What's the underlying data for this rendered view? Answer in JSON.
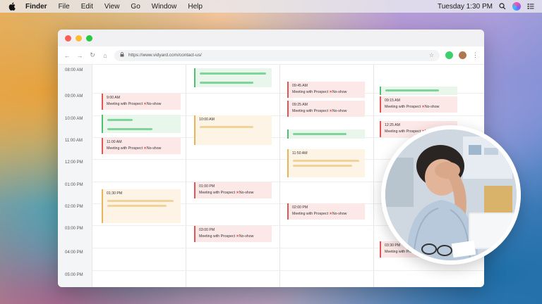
{
  "menubar": {
    "app_name": "Finder",
    "items": [
      "File",
      "Edit",
      "View",
      "Go",
      "Window",
      "Help"
    ],
    "clock": "Tuesday 1:30 PM",
    "icons": [
      "apple-icon",
      "search-icon",
      "siri-icon",
      "control-center-icon"
    ]
  },
  "browser": {
    "url": "https://www.vidyard.com/contact-us/",
    "traffic_lights": {
      "close": "#ff5f57",
      "minimize": "#febc2e",
      "zoom": "#28c840"
    }
  },
  "calendar": {
    "time_labels": [
      "08:00 AM",
      "09:00 AM",
      "10:00 AM",
      "11:00 AM",
      "12:00 PM",
      "01:00 PM",
      "02:00 PM",
      "03:00 PM",
      "04:00 PM",
      "05:00 PM"
    ],
    "events": {
      "e1_time": "9:00 AM",
      "e2_time": "11:00 AM",
      "e3_time": "01:30 PM",
      "e4_time": "10:00 AM",
      "e5_time": "01:00 PM",
      "e6_time": "03:00 PM",
      "e7_time": "09:45 AM",
      "e8_time": "09:25 AM",
      "e9_time": "11:50 AM",
      "e10_time": "02:00 PM",
      "e11_time": "09:15 AM",
      "e12_time": "12:25 AM",
      "e13_time": "03:30 PM",
      "title": "Meeting with Prospect",
      "status": "No-show",
      "status_mark": "✕"
    }
  },
  "colors": {
    "no_show_red": "#e05555",
    "placeholder_green": "#4fbf73",
    "placeholder_yellow": "#e6b45a"
  }
}
